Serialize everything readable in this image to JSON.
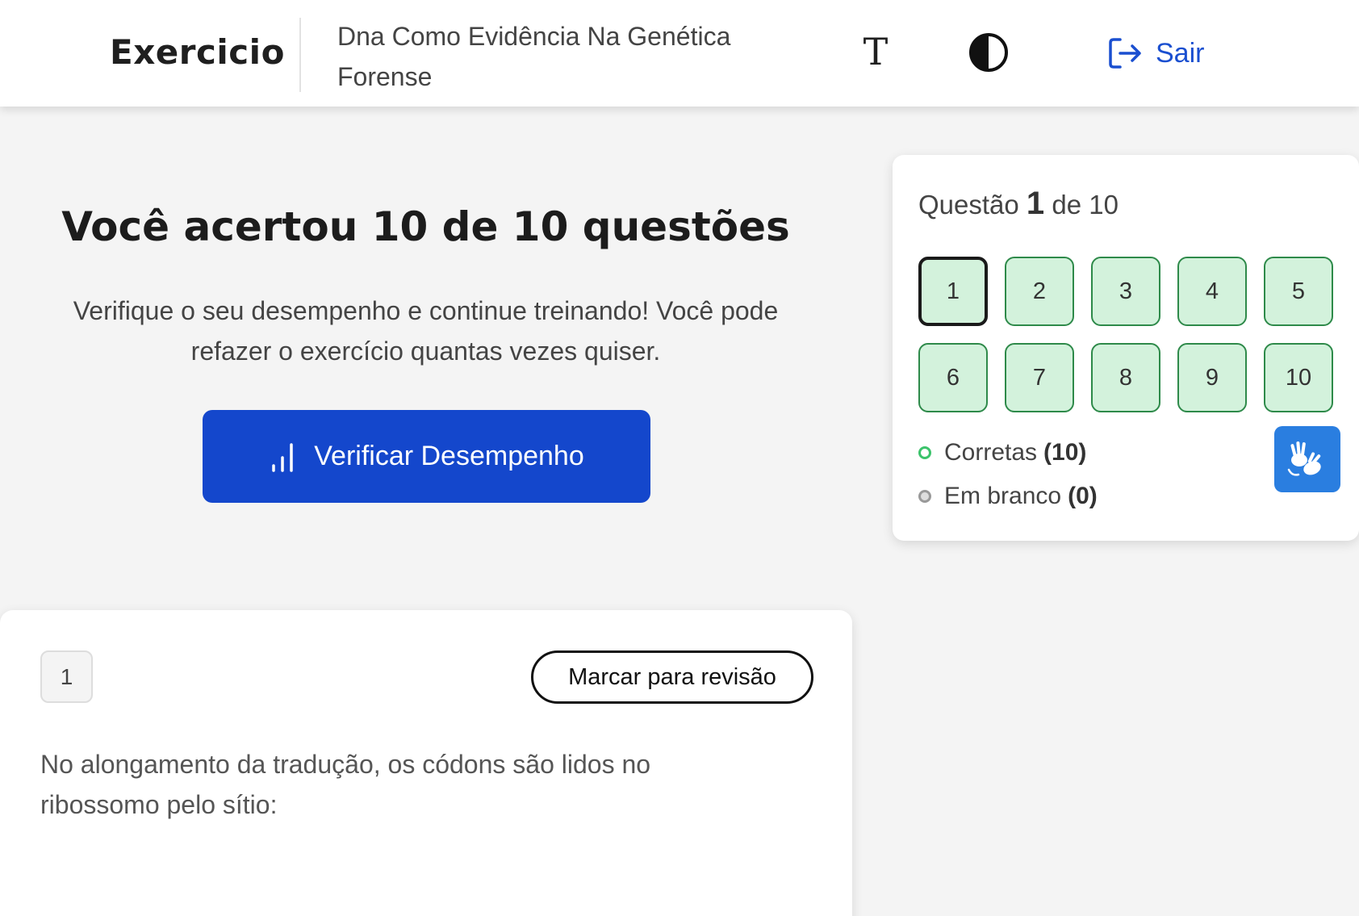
{
  "header": {
    "app_title": "Exercicio",
    "course_title": "Dna Como Evidência Na Genética Forense",
    "font_icon": "T",
    "logout_label": "Sair"
  },
  "result": {
    "title": "Você acertou 10 de 10 questões",
    "description": "Verifique o seu desempenho e continue treinando! Você pode refazer o exercício quantas vezes quiser.",
    "button_label": "Verificar Desempenho"
  },
  "panel": {
    "indicator_prefix": "Questão",
    "current": "1",
    "indicator_suffix": "de 10",
    "questions": [
      "1",
      "2",
      "3",
      "4",
      "5",
      "6",
      "7",
      "8",
      "9",
      "10"
    ],
    "correct_label": "Corretas",
    "correct_count": "(10)",
    "blank_label": "Em branco",
    "blank_count": "(0)"
  },
  "question": {
    "number": "1",
    "mark_label": "Marcar para revisão",
    "text": "No alongamento da tradução, os códons são lidos no ribossomo pelo sítio:"
  },
  "colors": {
    "primary": "#1447cc",
    "link": "#1a4fd0",
    "correct_fill": "#d3f2dc",
    "correct_border": "#2e8a4a",
    "libras": "#2a7ee0"
  }
}
